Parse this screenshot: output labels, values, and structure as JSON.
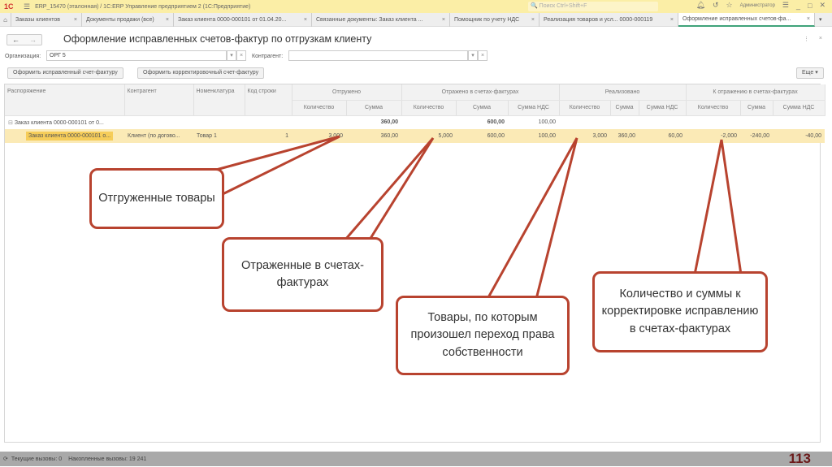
{
  "titlebar": {
    "title": "ERP_15470 (эталонная) / 1С:ERP Управление предприятием 2  (1С:Предприятие)",
    "search_placeholder": "Поиск Ctrl+Shift+F",
    "user": "Администратор"
  },
  "tabs": [
    {
      "label": "Заказы клиентов"
    },
    {
      "label": "Документы продажи (все)"
    },
    {
      "label": "Заказ клиента 0000-000101 от 01.04.20..."
    },
    {
      "label": "Связанные документы: Заказ клиента ..."
    },
    {
      "label": "Помощник по учету НДС"
    },
    {
      "label": "Реализация товаров и усл... 0000-000119"
    },
    {
      "label": "Оформление исправленных счетов-фа...",
      "active": true
    }
  ],
  "page": {
    "title": "Оформление исправленных счетов-фактур по отгрузкам клиенту",
    "org_label": "Организация:",
    "org_value": "ОРГ 5",
    "contragent_label": "Контрагент:",
    "contragent_value": "",
    "btn_fix": "Оформить исправленный счет-фактуру",
    "btn_corr": "Оформить корректировочный счет-фактуру",
    "btn_more": "Еще ▾"
  },
  "table": {
    "headers": {
      "order": "Распоряжение",
      "contragent": "Контрагент",
      "nomenclature": "Номенклатура",
      "line_code": "Код строки",
      "shipped": "Отгружено",
      "reflected": "Отражено в счетах-фактурах",
      "realized": "Реализовано",
      "to_reflect": "К отражению в счетах-фактурах",
      "qty": "Количество",
      "sum": "Сумма",
      "vat": "Сумма НДС"
    },
    "group": {
      "order": "Заказ клиента 0000-000101 от 0...",
      "shipped_sum": "360,00",
      "reflected_sum": "600,00",
      "reflected_vat": "100,00"
    },
    "rows": [
      {
        "order": "Заказ клиента 0000-000101 о...",
        "contragent": "Клиент (по догово...",
        "nomenclature": "Товар 1",
        "line_code": "1",
        "shipped_qty": "3,000",
        "shipped_sum": "360,00",
        "reflected_qty": "5,000",
        "reflected_sum": "600,00",
        "reflected_vat": "100,00",
        "realized_qty": "3,000",
        "realized_sum": "360,00",
        "realized_vat": "60,00",
        "to_reflect_qty": "-2,000",
        "to_reflect_sum": "-240,00",
        "to_reflect_vat": "-40,00"
      }
    ]
  },
  "callouts": {
    "c1": "Отгруженные товары",
    "c2": "Отраженные в счетах-фактурах",
    "c3": "Товары, по которым произошел переход права собственности",
    "c4": "Количество и суммы к корректировке исправлению в счетах-фактурах"
  },
  "status": {
    "current": "Текущие вызовы: 0",
    "accumulated": "Накопленные вызовы: 19 241"
  },
  "slide_number": "113",
  "colors": {
    "callout_border": "#b8432f",
    "selected_row": "#fbeab6",
    "titlebar": "#fbeea6"
  }
}
